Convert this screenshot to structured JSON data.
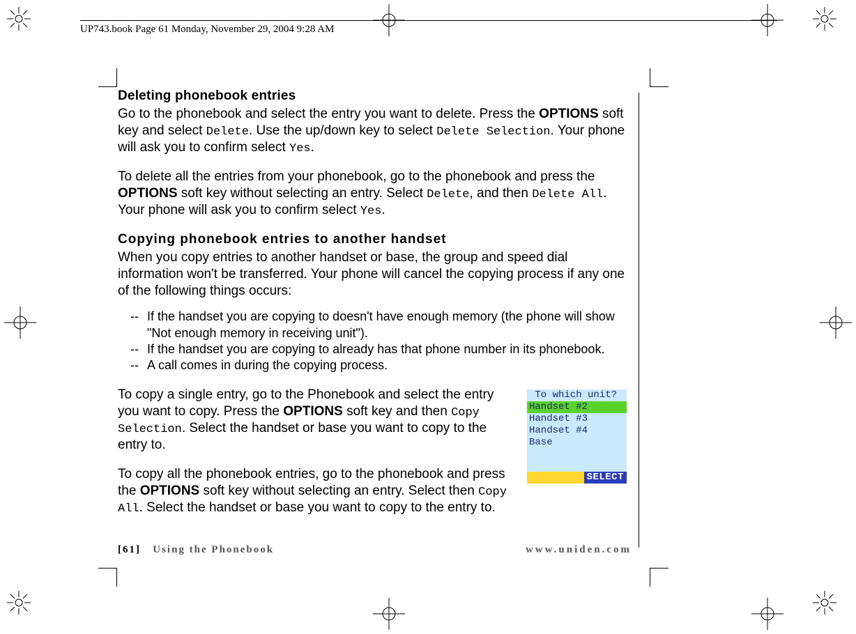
{
  "page_header": "UP743.book  Page 61  Monday, November 29, 2004  9:28 AM",
  "h_delete": "Deleting phonebook entries",
  "p1_a": "Go to the phonebook and select the entry you want to delete. Press the ",
  "p1_b": "OPTIONS",
  "p1_c": " soft key and select ",
  "p1_d": "Delete",
  "p1_e": ". Use the up/down key to select ",
  "p1_f": "Delete Selection",
  "p1_g": ". Your phone will ask you to confirm select ",
  "p1_h": "Yes",
  "p1_i": ".",
  "p2_a": "To delete all the entries from your phonebook, go to the phonebook and press the ",
  "p2_b": "OPTIONS",
  "p2_c": " soft key without selecting an entry. Select ",
  "p2_d": "Delete",
  "p2_e": ", and then ",
  "p2_f": "Delete All",
  "p2_g": ". Your phone will ask you to confirm select ",
  "p2_h": "Yes",
  "p2_i": ".",
  "h_copy": "Copying phonebook entries to another handset",
  "p3": "When you copy entries to another handset or base, the group and speed dial information won't be transferred. Your phone will cancel the copying process if any one of the following things occurs:",
  "bul_dash": "--",
  "bul1": "If the handset you are copying to doesn't have enough memory (the phone will show \"Not enough memory in receiving unit\").",
  "bul2": "If the handset you are copying to already has that phone number in its phonebook.",
  "bul3": "A call comes in during the copying process.",
  "p4_a": "To copy a single entry, go to the Phonebook and select the entry you want to copy. Press the ",
  "p4_b": "OPTIONS",
  "p4_c": " soft key and then ",
  "p4_d": "Copy Selection",
  "p4_e": ". Select the handset or base you want to copy to the entry to.",
  "p5_a": "To copy all the phonebook entries, go to the phonebook and press the ",
  "p5_b": "OPTIONS",
  "p5_c": " soft key without selecting an entry. Select then ",
  "p5_d": "Copy All",
  "p5_e": ". Select the handset or base you want to copy to the entry to.",
  "lcd": {
    "title": " To which unit?",
    "items": [
      "Handset #2",
      "Handset #3",
      "Handset #4",
      "Base"
    ],
    "selected_index": 0,
    "softkey": "SELECT"
  },
  "footer": {
    "page_no": "[61]",
    "section": "Using the Phonebook",
    "url": "www.uniden.com"
  }
}
